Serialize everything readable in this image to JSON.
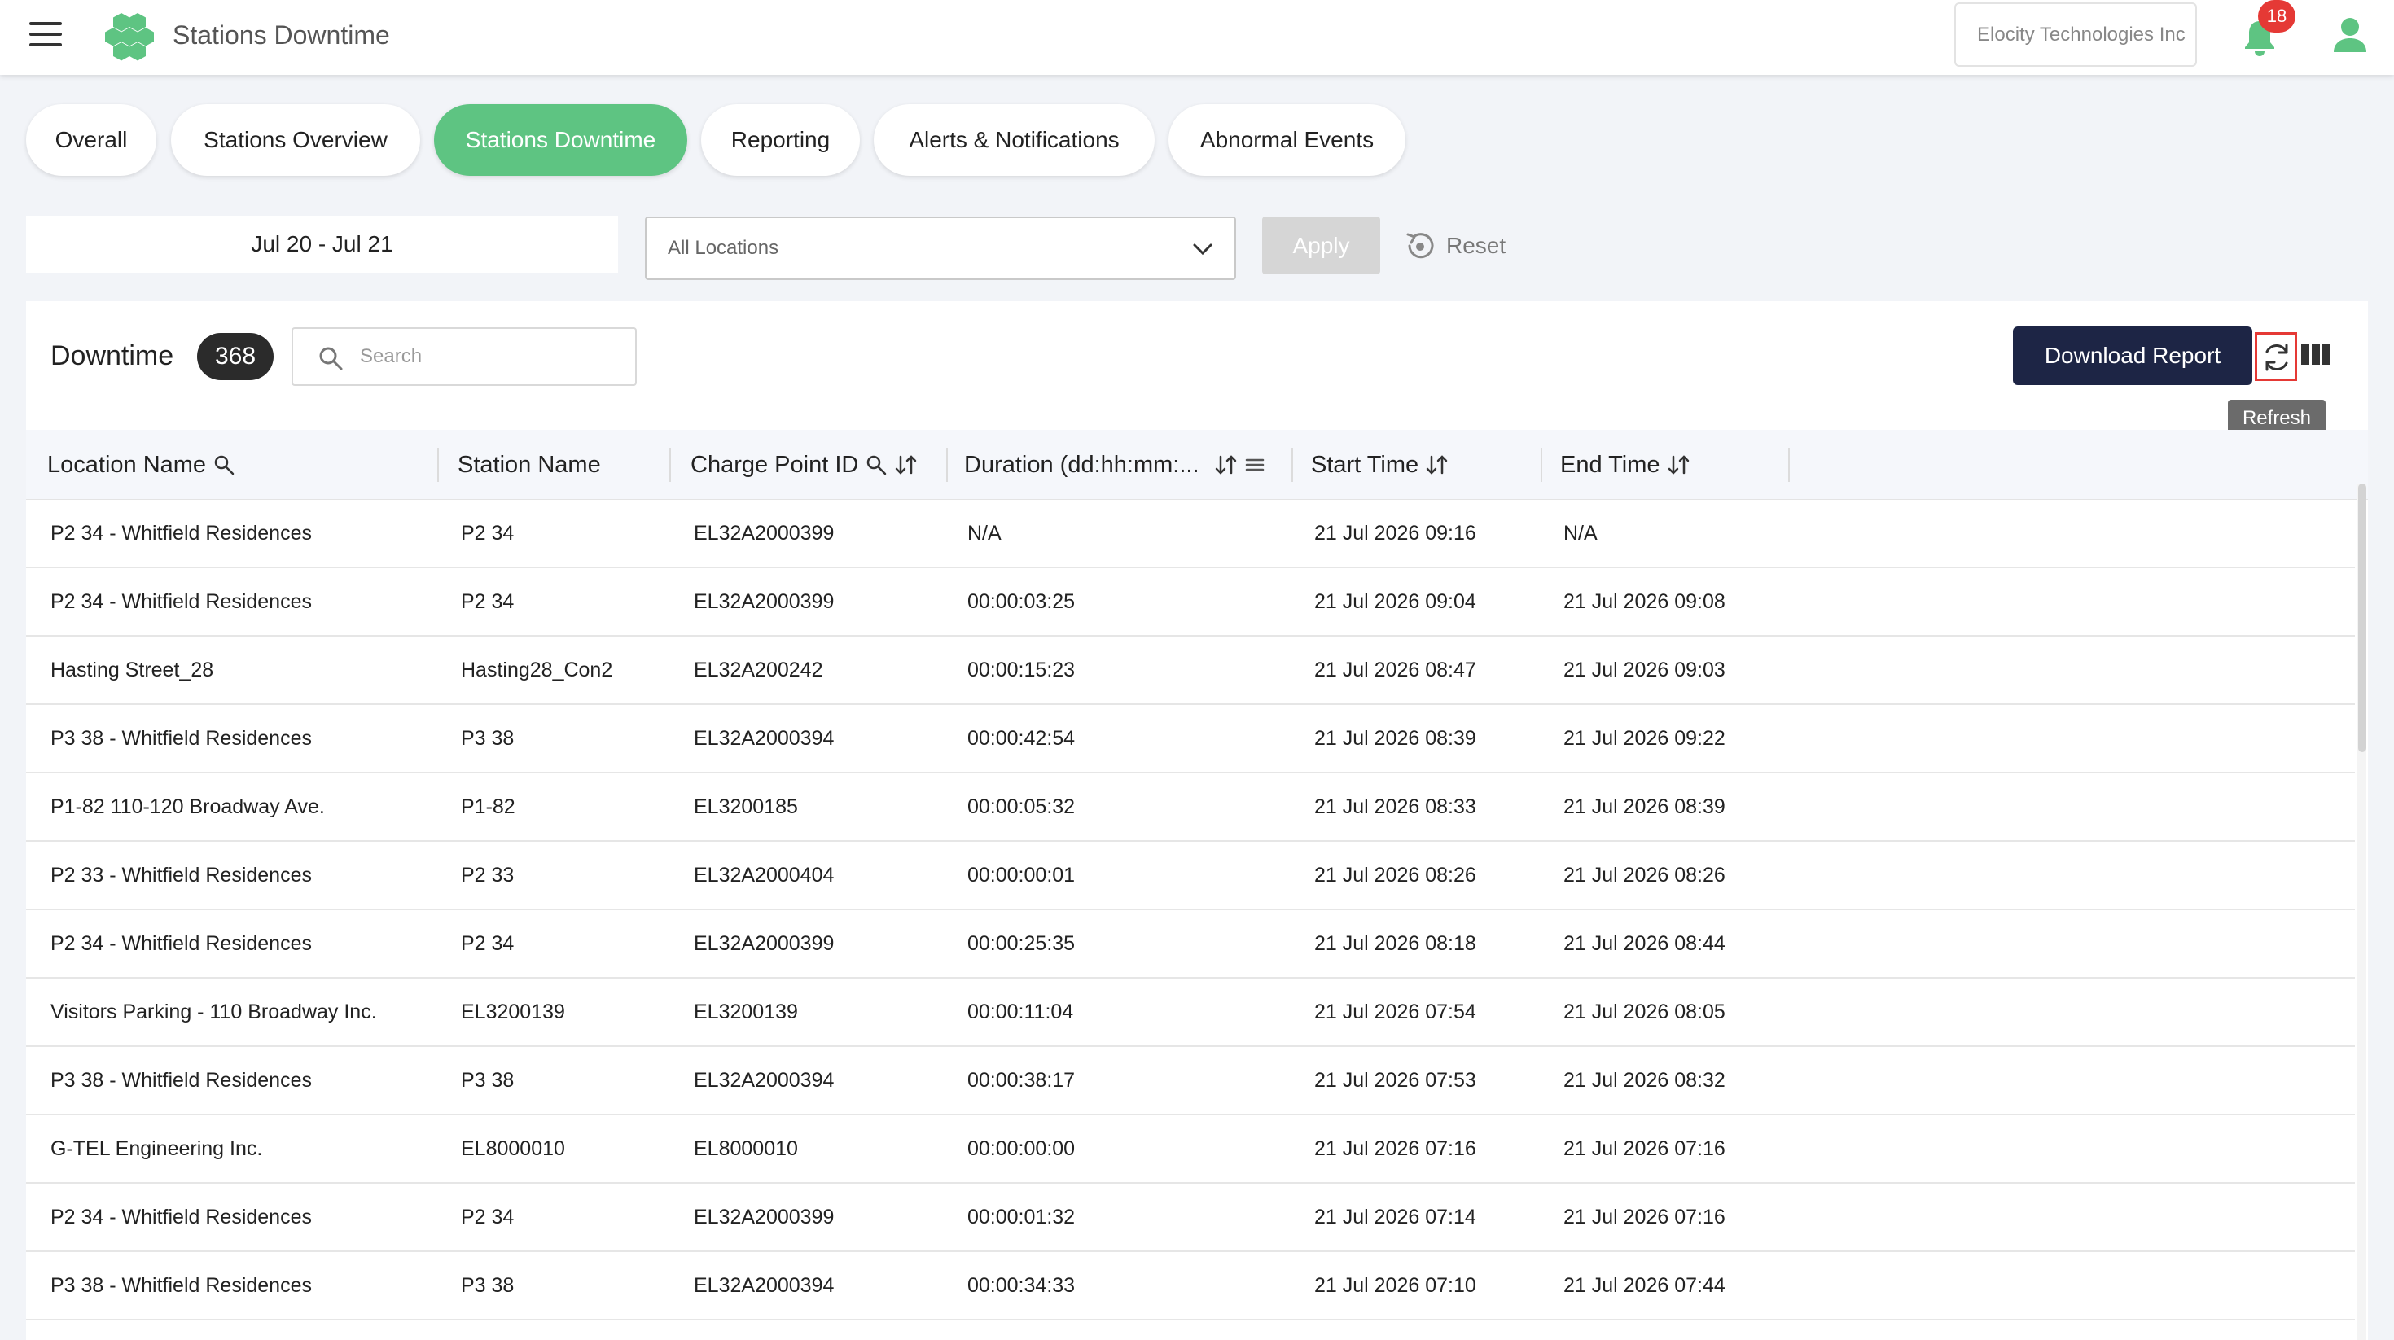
{
  "header": {
    "title": "Stations Downtime",
    "organization": "Elocity Technologies Inc",
    "notification_count": "18",
    "brand_color": "#5ec482"
  },
  "tabs": [
    {
      "label": "Overall",
      "active": false
    },
    {
      "label": "Stations Overview",
      "active": false
    },
    {
      "label": "Stations Downtime",
      "active": true
    },
    {
      "label": "Reporting",
      "active": false
    },
    {
      "label": "Alerts & Notifications",
      "active": false
    },
    {
      "label": "Abnormal Events",
      "active": false
    }
  ],
  "filters": {
    "date_range": "Jul 20 - Jul 21",
    "location_value": "All Locations",
    "apply_label": "Apply",
    "reset_label": "Reset"
  },
  "panel": {
    "title": "Downtime",
    "count": "368",
    "search_placeholder": "Search",
    "download_label": "Download Report",
    "refresh_tooltip": "Refresh"
  },
  "table": {
    "columns": [
      {
        "label": "Location Name"
      },
      {
        "label": "Station Name"
      },
      {
        "label": "Charge Point ID"
      },
      {
        "label": "Duration (dd:hh:mm:..."
      },
      {
        "label": "Start Time"
      },
      {
        "label": "End Time"
      }
    ],
    "rows": [
      [
        "P2 34 - Whitfield Residences",
        "P2 34",
        "EL32A2000399",
        "N/A",
        "21 Jul 2026 09:16",
        "N/A"
      ],
      [
        "P2 34 - Whitfield Residences",
        "P2 34",
        "EL32A2000399",
        "00:00:03:25",
        "21 Jul 2026 09:04",
        "21 Jul 2026 09:08"
      ],
      [
        "Hasting Street_28",
        "Hasting28_Con2",
        "EL32A200242",
        "00:00:15:23",
        "21 Jul 2026 08:47",
        "21 Jul 2026 09:03"
      ],
      [
        "P3 38 - Whitfield Residences",
        "P3 38",
        "EL32A2000394",
        "00:00:42:54",
        "21 Jul 2026 08:39",
        "21 Jul 2026 09:22"
      ],
      [
        "P1-82 110-120 Broadway Ave.",
        "P1-82",
        "EL3200185",
        "00:00:05:32",
        "21 Jul 2026 08:33",
        "21 Jul 2026 08:39"
      ],
      [
        "P2 33 - Whitfield Residences",
        "P2 33",
        "EL32A2000404",
        "00:00:00:01",
        "21 Jul 2026 08:26",
        "21 Jul 2026 08:26"
      ],
      [
        "P2 34 - Whitfield Residences",
        "P2 34",
        "EL32A2000399",
        "00:00:25:35",
        "21 Jul 2026 08:18",
        "21 Jul 2026 08:44"
      ],
      [
        "Visitors Parking - 110 Broadway Inc.",
        "EL3200139",
        "EL3200139",
        "00:00:11:04",
        "21 Jul 2026 07:54",
        "21 Jul 2026 08:05"
      ],
      [
        "P3 38 - Whitfield Residences",
        "P3 38",
        "EL32A2000394",
        "00:00:38:17",
        "21 Jul 2026 07:53",
        "21 Jul 2026 08:32"
      ],
      [
        "G-TEL Engineering Inc.",
        "EL8000010",
        "EL8000010",
        "00:00:00:00",
        "21 Jul 2026 07:16",
        "21 Jul 2026 07:16"
      ],
      [
        "P2 34 - Whitfield Residences",
        "P2 34",
        "EL32A2000399",
        "00:00:01:32",
        "21 Jul 2026 07:14",
        "21 Jul 2026 07:16"
      ],
      [
        "P3 38 - Whitfield Residences",
        "P3 38",
        "EL32A2000394",
        "00:00:34:33",
        "21 Jul 2026 07:10",
        "21 Jul 2026 07:44"
      ]
    ]
  }
}
